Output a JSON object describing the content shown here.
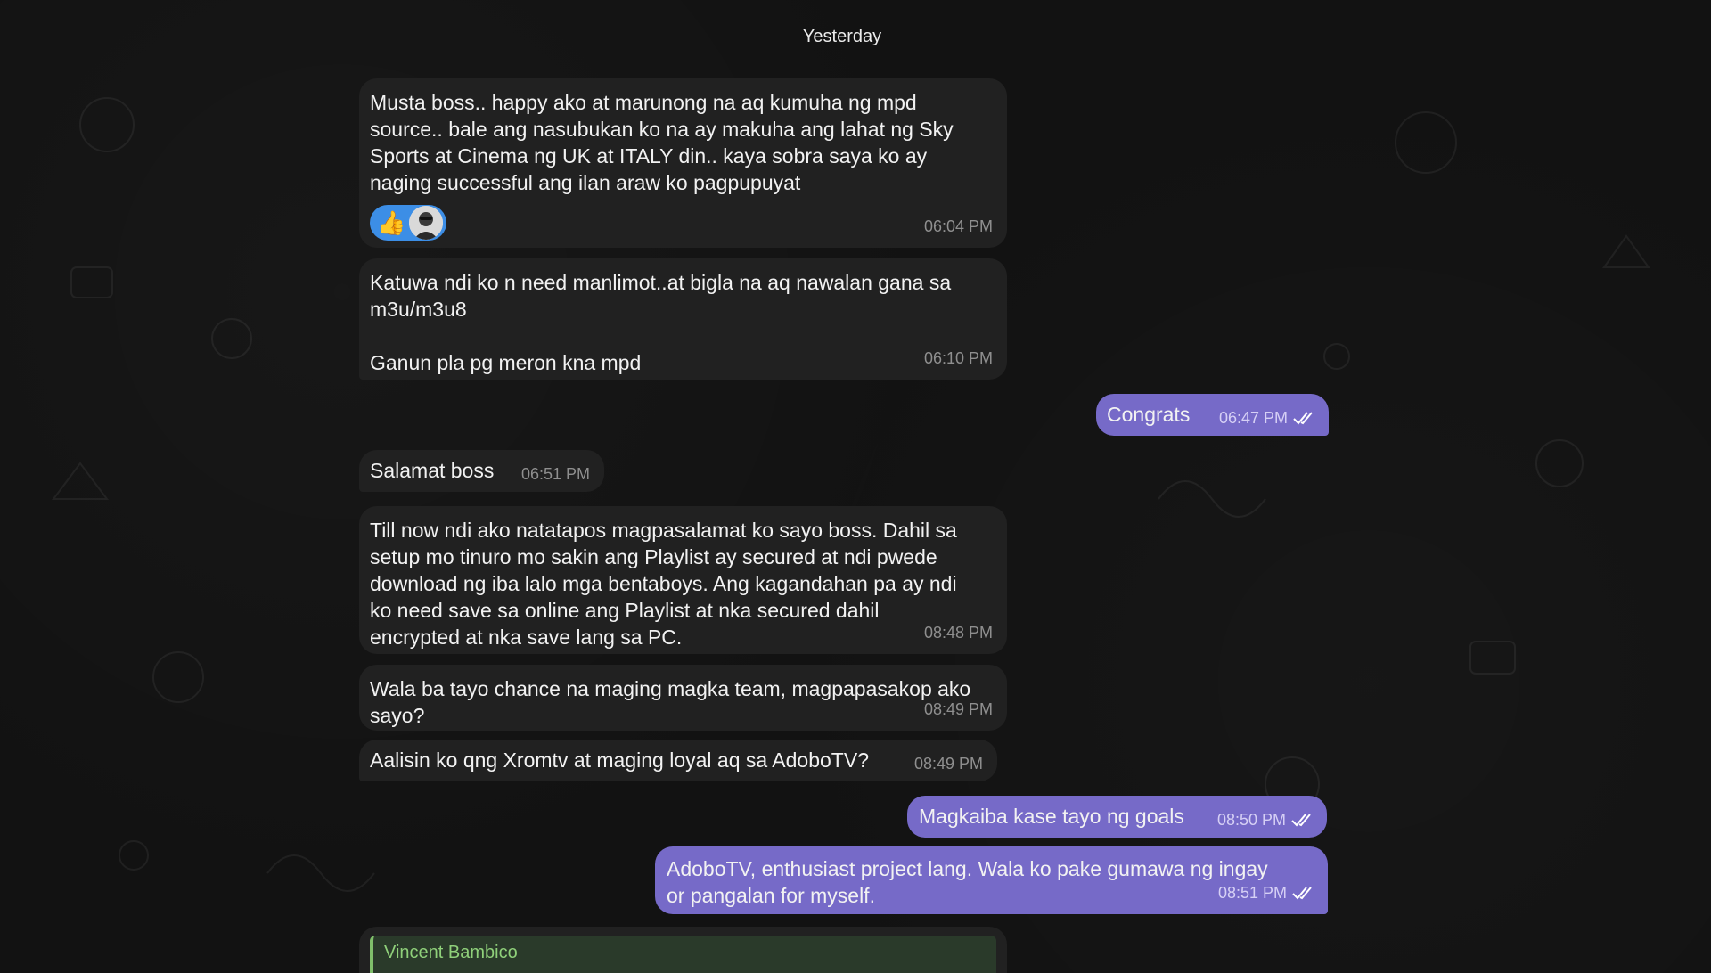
{
  "date_separator": "Yesterday",
  "messages": [
    {
      "text": "Musta boss.. happy ako at marunong na aq kumuha ng mpd\nsource.. bale ang nasubukan ko na ay makuha ang lahat ng Sky\nSports at Cinema ng UK at ITALY din.. kaya sobra saya ko ay\nnaging successful ang ilan araw ko pagpupuyat",
      "time": "06:04 PM",
      "reaction": "👍"
    },
    {
      "text": "Katuwa ndi ko n need manlimot..at bigla na aq nawalan gana sa\nm3u/m3u8\n\nGanun pla pg meron kna mpd",
      "time": "06:10 PM"
    },
    {
      "text": "Congrats",
      "time": "06:47 PM"
    },
    {
      "text": "Salamat boss",
      "time": "06:51 PM"
    },
    {
      "text": "Till now ndi ako natatapos magpasalamat ko sayo boss. Dahil sa\nsetup mo tinuro mo sakin ang Playlist ay secured at ndi pwede\ndownload ng iba lalo mga bentaboys. Ang kagandahan pa ay ndi\nko need save sa online ang Playlist at nka secured dahil\nencrypted at nka save lang sa PC.",
      "time": "08:48 PM"
    },
    {
      "text": "Wala ba tayo chance na maging magka team, magpapasakop ako\nsayo?",
      "time": "08:49 PM"
    },
    {
      "text": "Aalisin ko qng Xromtv at maging loyal aq sa AdoboTV?",
      "time": "08:49 PM"
    },
    {
      "text": "Magkaiba kase tayo ng goals",
      "time": "08:50 PM"
    },
    {
      "text": "AdoboTV, enthusiast project lang. Wala ko pake gumawa ng ingay\nor pangalan for myself.",
      "time": "08:51 PM"
    }
  ],
  "reply_preview": {
    "sender": "Vincent Bambico"
  },
  "colors": {
    "incoming": "#212121",
    "outgoing": "#766ac8",
    "reply_accent": "#7fbf6a"
  }
}
